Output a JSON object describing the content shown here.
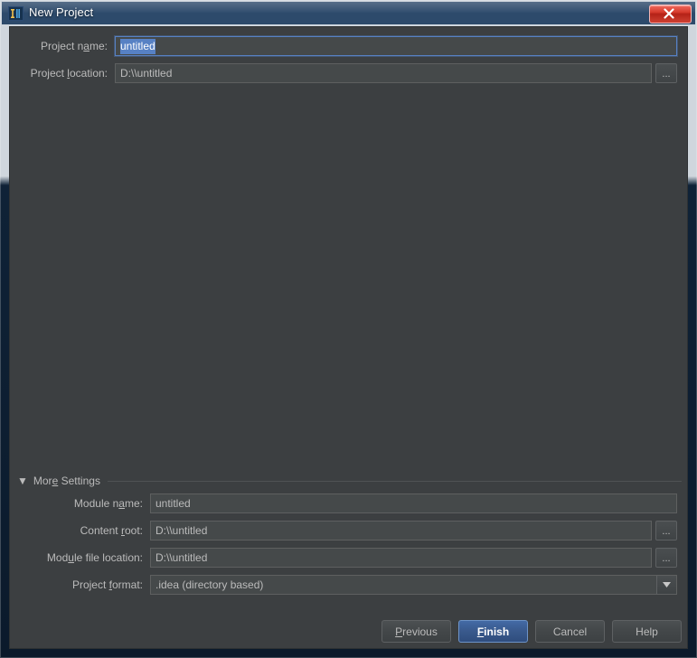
{
  "window": {
    "title": "New Project",
    "app_icon": "intellij-idea-icon",
    "close_label": "x",
    "accent_color": "#5781c4",
    "background_color": "#3c3f41",
    "default_button_color": "#39598c"
  },
  "form": {
    "project_name": {
      "label_pre": "Project n",
      "label_mn": "a",
      "label_post": "me:",
      "value": "untitled",
      "selected": true
    },
    "project_location": {
      "label_pre": "Project ",
      "label_mn": "l",
      "label_post": "ocation:",
      "value": "D:\\\\untitled",
      "browse_label": "..."
    }
  },
  "more_settings": {
    "triangle": "▼",
    "label_pre": "Mor",
    "label_mn": "e",
    "label_post": " Settings",
    "expanded": true,
    "fields": {
      "module_name": {
        "label_pre": "Module n",
        "label_mn": "a",
        "label_post": "me:",
        "value": "untitled"
      },
      "content_root": {
        "label_pre": "Content ",
        "label_mn": "r",
        "label_post": "oot:",
        "value": "D:\\\\untitled",
        "browse_label": "..."
      },
      "module_file_location": {
        "label_pre": "Mod",
        "label_mn": "u",
        "label_post": "le file location:",
        "value": "D:\\\\untitled",
        "browse_label": "..."
      },
      "project_format": {
        "label_pre": "Project ",
        "label_mn": "f",
        "label_post": "ormat:",
        "value": ".idea (directory based)",
        "arrow": "▼"
      }
    }
  },
  "buttons": {
    "previous": {
      "pre": "",
      "mn": "P",
      "post": "revious"
    },
    "finish": {
      "pre": "",
      "mn": "F",
      "post": "inish"
    },
    "cancel": {
      "pre": "Cancel",
      "mn": "",
      "post": ""
    },
    "help": {
      "pre": "Help",
      "mn": "",
      "post": ""
    }
  }
}
